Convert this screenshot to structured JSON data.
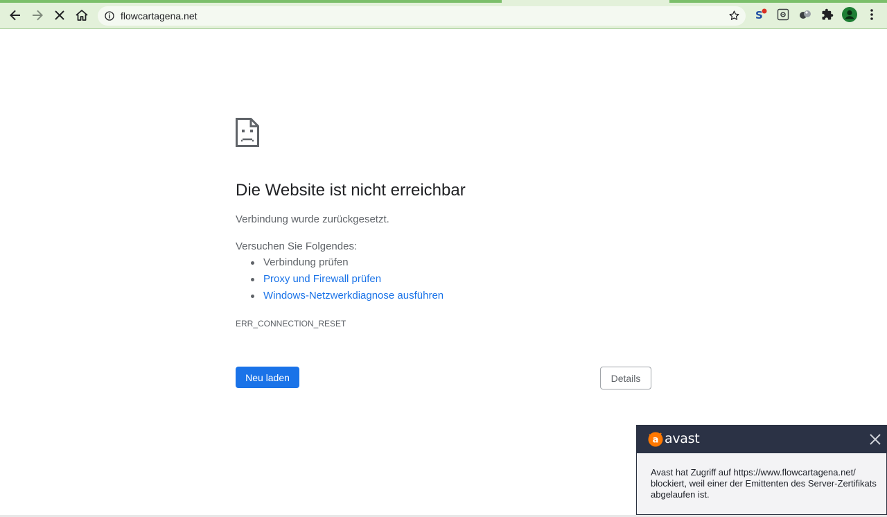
{
  "browser": {
    "url": "flowcartagena.net",
    "icons": {
      "back": "arrow-left-icon",
      "forward": "arrow-right-icon",
      "stop": "close-icon",
      "home": "home-icon",
      "site_info": "info-icon",
      "bookmark": "star-icon",
      "extensions": "puzzle-icon",
      "profile": "avatar-icon",
      "menu": "kebab-menu-icon"
    },
    "colors": {
      "toolbar_bg": "#e3f1da",
      "load_bar": "#7bbf6a"
    }
  },
  "error_page": {
    "title": "Die Website ist nicht erreichbar",
    "subtitle": "Verbindung wurde zurückgesetzt.",
    "suggestions_heading": "Versuchen Sie Folgendes:",
    "suggestions": [
      {
        "label": "Verbindung prüfen",
        "is_link": false
      },
      {
        "label": "Proxy und Firewall prüfen",
        "is_link": true
      },
      {
        "label": "Windows-Netzwerkdiagnose ausführen",
        "is_link": true
      }
    ],
    "error_code": "ERR_CONNECTION_RESET",
    "reload_label": "Neu laden",
    "details_label": "Details",
    "colors": {
      "link": "#1a73e8",
      "primary_button": "#1a73e8"
    }
  },
  "avast_popup": {
    "brand": "avast",
    "message": "Avast hat Zugriff auf https://www.flowcartagena.net/ blockiert, weil einer der Emittenten des Server-Zertifikats abgelaufen ist.",
    "colors": {
      "header_bg": "#2b3245",
      "logo": "#ff7800"
    }
  }
}
